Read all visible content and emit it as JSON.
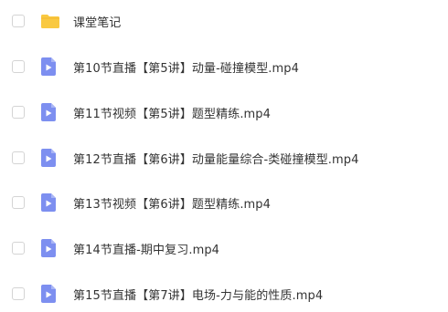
{
  "files": [
    {
      "name": "课堂笔记",
      "icon": "folder-icon"
    },
    {
      "name": "第10节直播【第5讲】动量-碰撞模型.mp4",
      "icon": "video-icon"
    },
    {
      "name": "第11节视频【第5讲】题型精练.mp4",
      "icon": "video-icon"
    },
    {
      "name": "第12节直播【第6讲】动量能量综合-类碰撞模型.mp4",
      "icon": "video-icon"
    },
    {
      "name": "第13节视频【第6讲】题型精练.mp4",
      "icon": "video-icon"
    },
    {
      "name": "第14节直播-期中复习.mp4",
      "icon": "video-icon"
    },
    {
      "name": "第15节直播【第7讲】电场-力与能的性质.mp4",
      "icon": "video-icon"
    }
  ],
  "colors": {
    "folder": "#f9c941",
    "video": "#7d8ff0",
    "checkbox_border": "#d4d4d4",
    "text": "#333333"
  }
}
